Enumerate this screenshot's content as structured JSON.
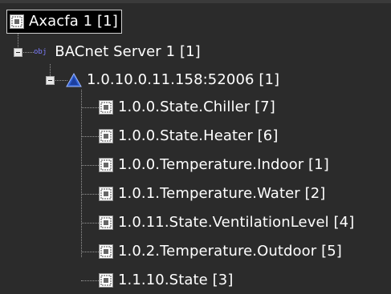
{
  "tree": {
    "root": {
      "label": "Axacfa 1 [1]",
      "icon": "module-icon"
    },
    "server": {
      "label": "BACnet Server 1 [1]",
      "icon_text": "obj"
    },
    "device": {
      "label": "1.0.10.0.11.158:52006 [1]",
      "icon": "triangle-icon"
    },
    "items": [
      {
        "label": "1.0.0.State.Chiller [7]"
      },
      {
        "label": "1.0.0.State.Heater [6]"
      },
      {
        "label": "1.0.0.Temperature.Indoor [1]"
      },
      {
        "label": "1.0.1.Temperature.Water [2]"
      },
      {
        "label": "1.0.11.State.VentilationLevel [4]"
      },
      {
        "label": "1.0.2.Temperature.Outdoor [5]"
      },
      {
        "label": "1.1.10.State [3]"
      }
    ]
  }
}
